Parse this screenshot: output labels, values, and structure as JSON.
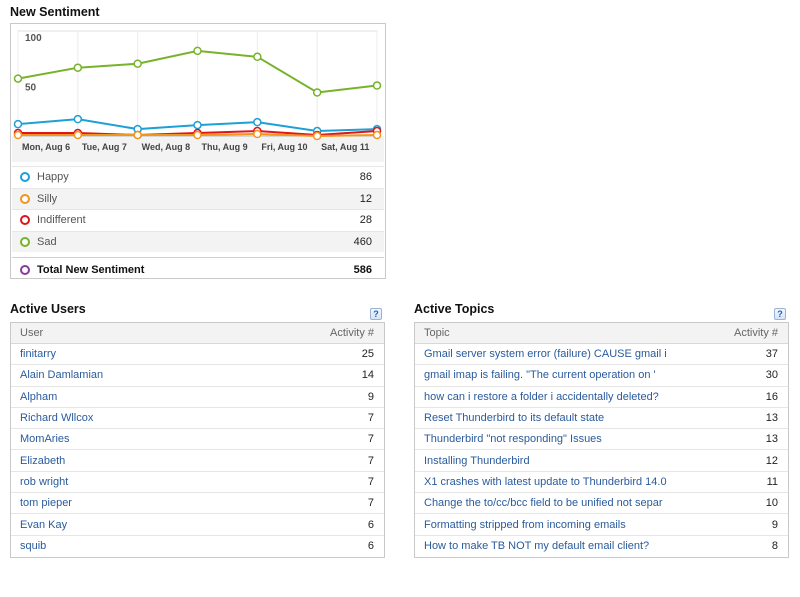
{
  "sentiment": {
    "title": "New Sentiment",
    "chart_data": {
      "type": "line",
      "categories": [
        "Mon, Aug 6",
        "Tue, Aug 7",
        "Wed, Aug 8",
        "Thu, Aug 9",
        "Fri, Aug 10",
        "Sat, Aug 11",
        ""
      ],
      "ylim": [
        0,
        100
      ],
      "yticks": [
        "100",
        "50",
        "0"
      ],
      "grid": true,
      "series": [
        {
          "name": "Sad",
          "color": "#77b32a",
          "values": [
            58,
            69,
            73,
            86,
            80,
            44,
            51
          ]
        },
        {
          "name": "Happy",
          "color": "#1e9fd6",
          "values": [
            12,
            17,
            7,
            11,
            14,
            5,
            7
          ]
        },
        {
          "name": "Indifferent",
          "color": "#e3131a",
          "values": [
            3,
            3,
            1,
            3,
            5,
            1,
            5
          ]
        },
        {
          "name": "Silly",
          "color": "#f0961e",
          "values": [
            1,
            1,
            1,
            1,
            2,
            0,
            1
          ]
        }
      ]
    },
    "legend": [
      {
        "label": "Happy",
        "value": "86",
        "color": "#1e9fd6"
      },
      {
        "label": "Silly",
        "value": "12",
        "color": "#f0961e"
      },
      {
        "label": "Indifferent",
        "value": "28",
        "color": "#e3131a"
      },
      {
        "label": "Sad",
        "value": "460",
        "color": "#77b32a"
      }
    ],
    "total": {
      "label": "Total New Sentiment",
      "value": "586",
      "color": "#8a3a9c"
    }
  },
  "active_users": {
    "title": "Active Users",
    "help": "?",
    "col_user": "User",
    "col_activity": "Activity #",
    "rows": [
      {
        "name": "finitarry",
        "activity": "25"
      },
      {
        "name": "Alain Damlamian",
        "activity": "14"
      },
      {
        "name": "Alpham",
        "activity": "9"
      },
      {
        "name": "Richard Wllcox",
        "activity": "7"
      },
      {
        "name": "MomAries",
        "activity": "7"
      },
      {
        "name": "Elizabeth",
        "activity": "7"
      },
      {
        "name": "rob wright",
        "activity": "7"
      },
      {
        "name": "tom pieper",
        "activity": "7"
      },
      {
        "name": "Evan Kay",
        "activity": "6"
      },
      {
        "name": "squib",
        "activity": "6"
      }
    ]
  },
  "active_topics": {
    "title": "Active Topics",
    "help": "?",
    "col_topic": "Topic",
    "col_activity": "Activity #",
    "rows": [
      {
        "name": "Gmail server system error (failure) CAUSE gmail i",
        "activity": "37"
      },
      {
        "name": "gmail imap is failing. \"The current operation on '",
        "activity": "30"
      },
      {
        "name": "how can i restore a folder i accidentally deleted?",
        "activity": "16"
      },
      {
        "name": "Reset Thunderbird to its default state",
        "activity": "13"
      },
      {
        "name": "Thunderbird \"not responding\" Issues",
        "activity": "13"
      },
      {
        "name": "Installing Thunderbird",
        "activity": "12"
      },
      {
        "name": "X1 crashes with latest update to Thunderbird 14.0",
        "activity": "11"
      },
      {
        "name": "Change the to/cc/bcc field to be unified not separ",
        "activity": "10"
      },
      {
        "name": "Formatting stripped from incoming emails",
        "activity": "9"
      },
      {
        "name": "How to make TB NOT my default email client?",
        "activity": "8"
      }
    ]
  }
}
